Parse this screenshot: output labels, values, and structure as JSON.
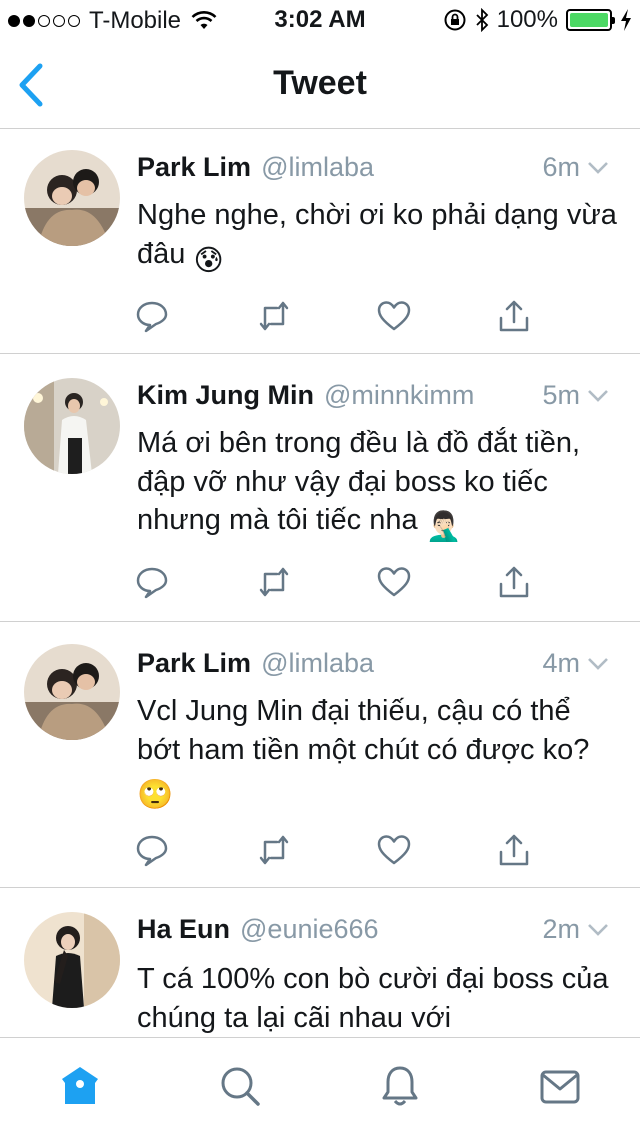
{
  "status_bar": {
    "carrier": "T-Mobile",
    "time": "3:02 AM",
    "battery": "100%",
    "signal_bars_filled": 2,
    "signal_bars_total": 5
  },
  "nav": {
    "title": "Tweet",
    "back_icon": "chevron-left-icon"
  },
  "tweets": [
    {
      "name": "Park Lim",
      "handle": "@limlaba",
      "time": "6m",
      "text": "Nghe nghe, chời ơi ko phải dạng vừa đâu",
      "emoji": "😰"
    },
    {
      "name": "Kim Jung Min",
      "handle": "@minnkimm",
      "time": "5m",
      "text": "Má ơi bên trong đều là đồ đắt tiền, đập vỡ như vậy đại boss ko tiếc nhưng mà tôi tiếc nha",
      "emoji": "🤦🏻‍♂️"
    },
    {
      "name": "Park Lim",
      "handle": "@limlaba",
      "time": "4m",
      "text": "Vcl Jung Min đại thiếu, cậu có thể bớt ham tiền một chút có được ko?",
      "emoji": "🙄"
    },
    {
      "name": "Ha Eun",
      "handle": "@eunie666",
      "time": "2m",
      "text": "T cá 100% con bò cười đại boss của chúng ta lại cãi nhau với",
      "emoji": ""
    }
  ],
  "tweet_actions": [
    "reply-icon",
    "retweet-icon",
    "like-icon",
    "share-icon"
  ],
  "tabbar": {
    "tabs": [
      "home-icon",
      "search-icon",
      "notifications-icon",
      "messages-icon"
    ],
    "active": "home-icon"
  },
  "colors": {
    "accent": "#1da1f2",
    "text": "#14171a",
    "secondary": "#8899a6",
    "icon": "#657786",
    "battery": "#4cd964"
  }
}
